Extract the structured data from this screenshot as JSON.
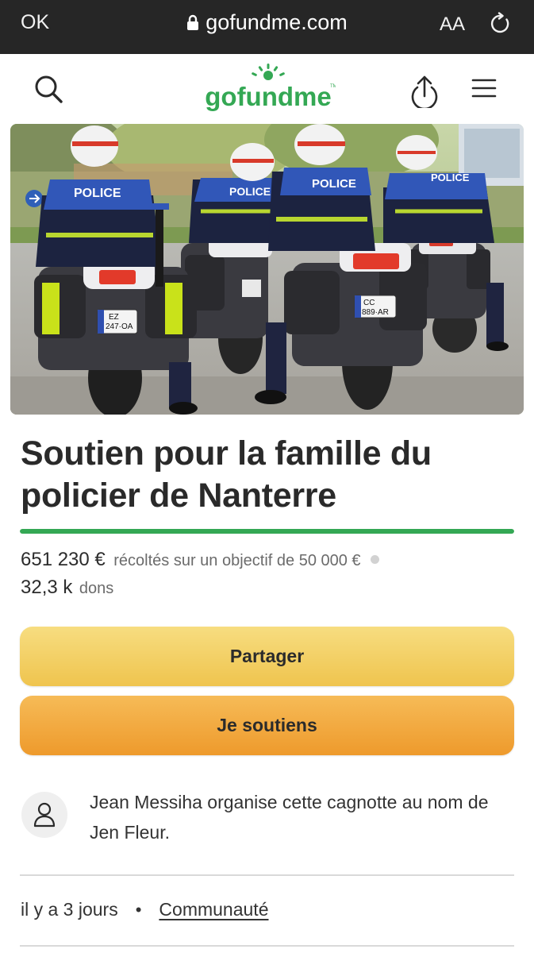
{
  "browser": {
    "ok_label": "OK",
    "domain": "gofundme.com",
    "text_size_label": "AA",
    "reload_icon": "reload-icon",
    "lock_icon": "lock-icon"
  },
  "header": {
    "logo_text": "gofundme",
    "brand_color": "#34a854",
    "icons": [
      "search-icon",
      "share-icon",
      "menu-icon"
    ]
  },
  "hero": {
    "description_icon": "campaign-photo",
    "plate_left": "EZ-247-OA",
    "plate_right": "CC-889-AR",
    "vest_text": "POLICE"
  },
  "campaign": {
    "title": "Soutien pour la famille du policier de Nanterre",
    "raised": "651 230 €",
    "goal_text": "récoltés sur un objectif de 50 000 €",
    "progress_fraction": 1.0,
    "donations_count": "32,3 k",
    "donations_label": "dons"
  },
  "actions": {
    "share_label": "Partager",
    "donate_label": "Je soutiens"
  },
  "organizer": {
    "text": "Jean Messiha organise cette cagnotte au nom de Jen Fleur."
  },
  "meta": {
    "time_ago": "il y a 3 jours",
    "category": "Communauté"
  }
}
